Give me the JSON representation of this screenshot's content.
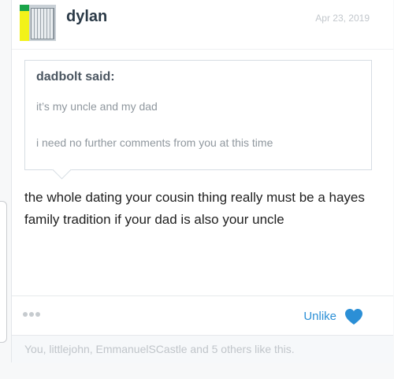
{
  "post": {
    "author": "dylan",
    "date": "Apr 23, 2019",
    "quote": {
      "author_label": "dadbolt said:",
      "lines": [
        "it’s my uncle and my dad",
        "i need no further comments from you at this time"
      ]
    },
    "message": "the whole dating your cousin thing really must be a hayes family tradition if your dad is also your uncle",
    "actions": {
      "unlike_label": "Unlike"
    },
    "likes_summary": "You, littlejohn, EmmanuelSCastle and 5 others like this."
  },
  "colors": {
    "accent": "#2b8fd6",
    "heart": "#2b8fd6"
  },
  "icons": {
    "more": "more-dots-icon",
    "like": "heart-icon"
  }
}
